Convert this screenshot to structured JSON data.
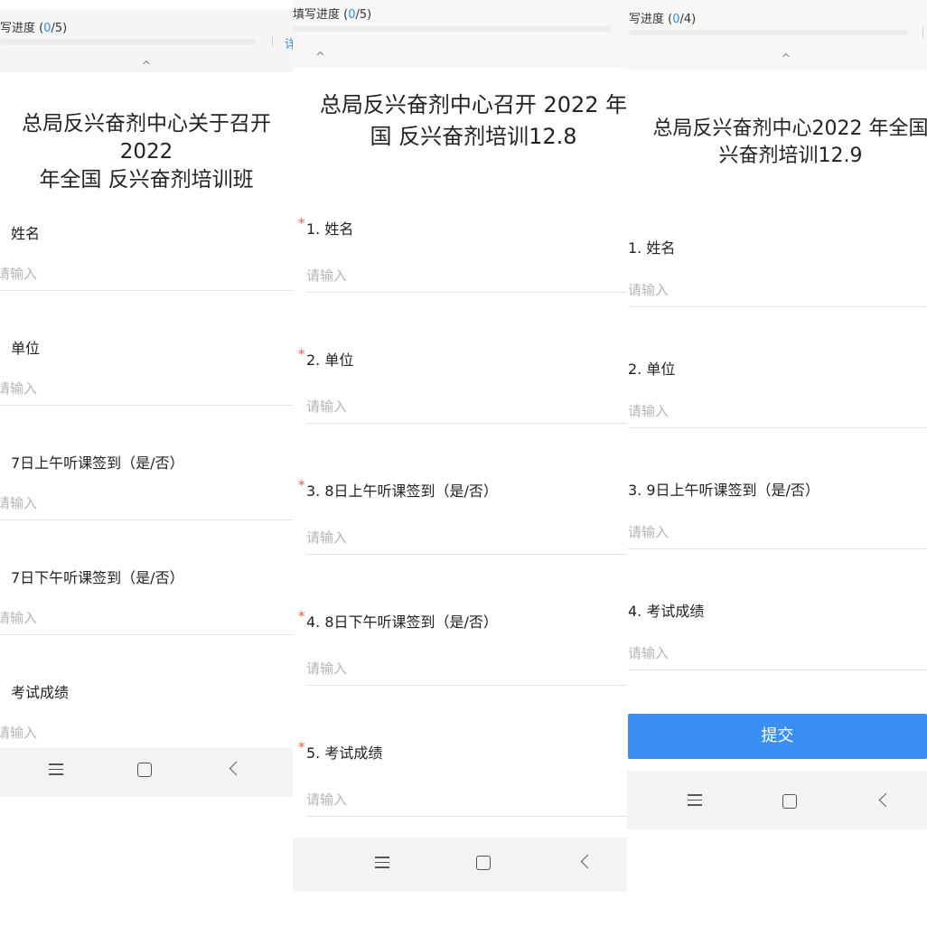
{
  "panel1": {
    "progress": {
      "prefix": "写进度 (",
      "current": "0",
      "total_suffix": "/5)"
    },
    "side_link": "详",
    "caret": "^",
    "title_line1": "总局反兴奋剂中心关于召开 2022",
    "title_line2": "年全国 反兴奋剂培训班",
    "fields": [
      {
        "label": "姓名",
        "placeholder": "请输入"
      },
      {
        "label": "单位",
        "placeholder": "请输入"
      },
      {
        "label": "7日上午听课签到（是/否）",
        "placeholder": "请输入"
      },
      {
        "label": "7日下午听课签到（是/否）",
        "placeholder": "请输入"
      },
      {
        "label": "考试成绩",
        "placeholder": "请输入"
      }
    ]
  },
  "panel2": {
    "progress": {
      "prefix": "填写进度 (",
      "current": "0",
      "total_suffix": "/5)"
    },
    "caret": "^",
    "title_line1": "总局反兴奋剂中心召开 2022 年",
    "title_line2": "国 反兴奋剂培训12.8",
    "required_mark": "*",
    "fields": [
      {
        "label": "1.  姓名",
        "placeholder": "请输入"
      },
      {
        "label": "2.  单位",
        "placeholder": "请输入"
      },
      {
        "label": "3.  8日上午听课签到（是/否）",
        "placeholder": "请输入"
      },
      {
        "label": "4.  8日下午听课签到（是/否）",
        "placeholder": "请输入"
      },
      {
        "label": "5.  考试成绩",
        "placeholder": "请输入"
      }
    ]
  },
  "panel3": {
    "progress": {
      "prefix": "写进度 (",
      "current": "0",
      "total_suffix": "/4)"
    },
    "caret": "^",
    "title_line1": "总局反兴奋剂中心2022 年全国",
    "title_line2": "兴奋剂培训12.9",
    "fields": [
      {
        "label": "1.  姓名",
        "placeholder": "请输入"
      },
      {
        "label": "2.  单位",
        "placeholder": "请输入"
      },
      {
        "label": "3.  9日上午听课签到（是/否）",
        "placeholder": "请输入"
      },
      {
        "label": "4.  考试成绩",
        "placeholder": "请输入"
      }
    ],
    "submit_label": "提交"
  },
  "colors": {
    "accent": "#2f8cf0",
    "button": "#3b8ff3",
    "required": "#e35d4a",
    "placeholder": "#b5b5b5"
  },
  "icons": [
    "menu-icon",
    "home-icon",
    "back-icon",
    "chevron-up-icon"
  ]
}
